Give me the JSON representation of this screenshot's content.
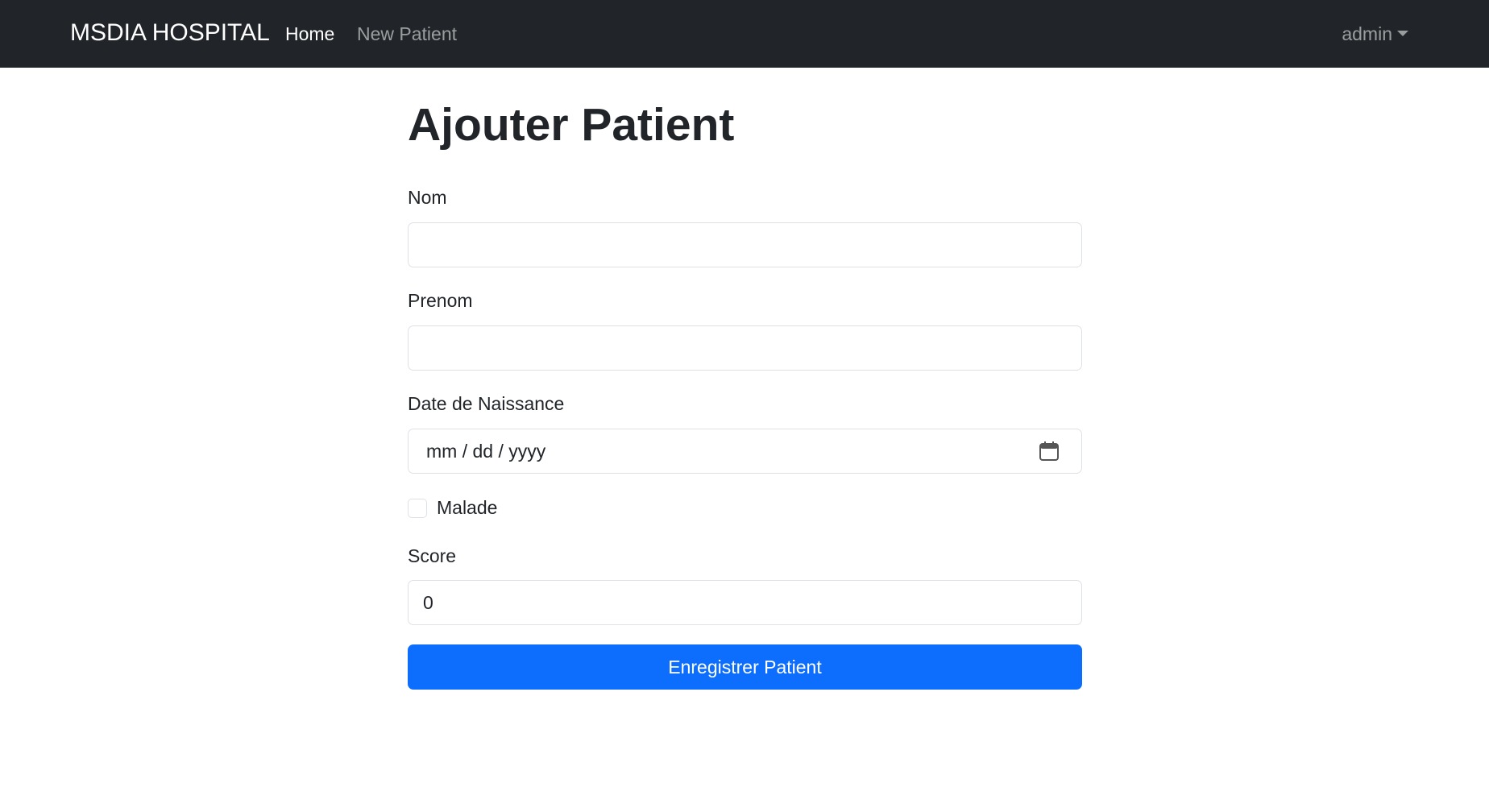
{
  "navbar": {
    "brand": "MSDIA HOSPITAL",
    "links": [
      {
        "label": "Home",
        "active": true
      },
      {
        "label": "New Patient",
        "active": false
      }
    ],
    "user": "admin"
  },
  "form": {
    "title": "Ajouter Patient",
    "nom_label": "Nom",
    "nom_value": "",
    "prenom_label": "Prenom",
    "prenom_value": "",
    "date_label": "Date de Naissance",
    "date_placeholder": "mm / dd / yyyy",
    "malade_label": "Malade",
    "malade_checked": false,
    "score_label": "Score",
    "score_value": "0",
    "submit_label": "Enregistrer Patient"
  },
  "colors": {
    "navbar_bg": "#212529",
    "primary": "#0d6efd",
    "border": "#dee2e6"
  },
  "icons": {
    "date_picker": "calendar-icon",
    "user_menu": "chevron-down-icon"
  }
}
